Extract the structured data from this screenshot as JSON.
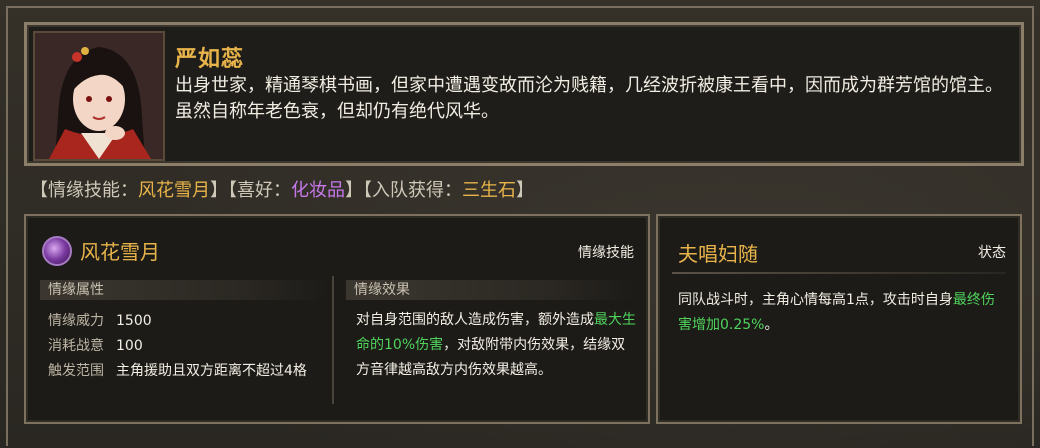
{
  "character": {
    "name": "严如蕊",
    "description": "出身世家，精通琴棋书画，但家中遭遇变故而沦为贱籍，几经波折被康王看中，因而成为群芳馆的馆主。虽然自称年老色衰，但却仍有绝代风华。"
  },
  "meta": {
    "skill_label": "【情缘技能：",
    "skill_value": "风花雪月",
    "hobby_label": "】【喜好：",
    "hobby_value": "化妆品",
    "join_label": "】【入队获得：",
    "join_value": "三生石",
    "end": "】"
  },
  "skill": {
    "icon": "flower-swirl-icon",
    "name": "风花雪月",
    "type": "情缘技能",
    "attributes_header": "情缘属性",
    "attributes": [
      {
        "key": "情缘威力",
        "value": "1500"
      },
      {
        "key": "消耗战意",
        "value": "100"
      },
      {
        "key": "触发范围",
        "value": "主角援助且双方距离不超过4格"
      }
    ],
    "effect_header": "情缘效果",
    "effect_part1": "对自身范围的敌人造成伤害，额外造成",
    "effect_highlight": "最大生命的10%伤害",
    "effect_part2": "，对敌附带内伤效果，结缘双方音律越高敌方内伤效果越高。"
  },
  "state": {
    "name": "夫唱妇随",
    "type": "状态",
    "text_part1": "同队战斗时，主角心情每高1点，攻击时自身",
    "text_highlight": "最终伤害增加0.25%",
    "text_part2": "。"
  },
  "colors": {
    "gold": "#e8b44a",
    "purple": "#c678e8",
    "green": "#4fd35c"
  }
}
